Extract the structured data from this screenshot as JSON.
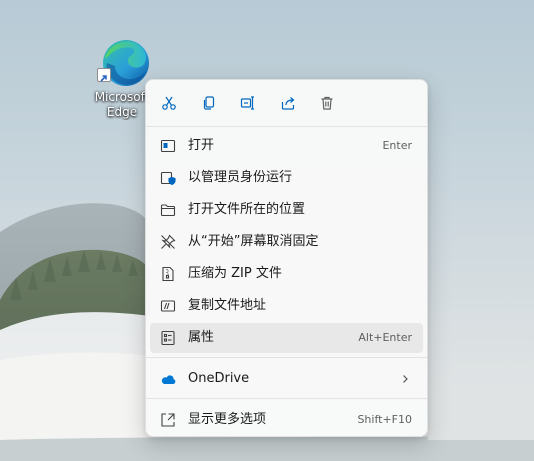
{
  "desktop": {
    "icon_label_line1": "Microsoft",
    "icon_label_line2": "Edge",
    "icon_name": "edge-icon",
    "shortcut_overlay": "shortcut-arrow-icon"
  },
  "menu": {
    "toolbar": [
      {
        "name": "cut-button",
        "icon": "scissors-icon"
      },
      {
        "name": "copy-button",
        "icon": "copy-icon"
      },
      {
        "name": "rename-button",
        "icon": "rename-icon"
      },
      {
        "name": "share-button",
        "icon": "share-icon"
      },
      {
        "name": "delete-button",
        "icon": "trash-icon"
      }
    ],
    "items": [
      {
        "label": "打开",
        "accel": "Enter",
        "icon": "open-icon"
      },
      {
        "label": "以管理员身份运行",
        "accel": "",
        "icon": "shield-icon"
      },
      {
        "label": "打开文件所在的位置",
        "accel": "",
        "icon": "folder-icon"
      },
      {
        "label": "从“开始”屏幕取消固定",
        "accel": "",
        "icon": "unpin-icon"
      },
      {
        "label": "压缩为 ZIP 文件",
        "accel": "",
        "icon": "zip-icon"
      },
      {
        "label": "复制文件地址",
        "accel": "",
        "icon": "copy-path-icon"
      },
      {
        "label": "属性",
        "accel": "Alt+Enter",
        "icon": "properties-icon",
        "selected": true
      }
    ],
    "onedrive": {
      "label": "OneDrive",
      "icon": "cloud-icon",
      "submenu": "chevron-right-icon"
    },
    "more": {
      "label": "显示更多选项",
      "accel": "Shift+F10",
      "icon": "more-options-icon"
    }
  },
  "colors": {
    "accent": "#0067c0",
    "menu_bg": "#f9f9f9",
    "selected_bg": "#e8e8e8",
    "onedrive": "#0078d4"
  }
}
